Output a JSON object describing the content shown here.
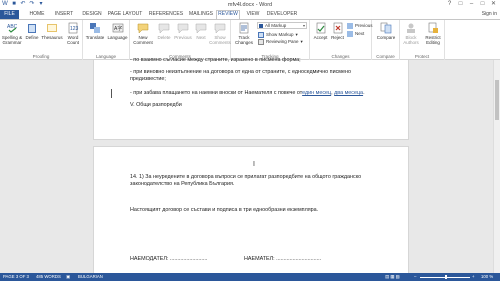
{
  "titlebar": {
    "title": "mfv4l.docx - Word",
    "qat": [
      "W",
      "■",
      "↶",
      "↷",
      "▾"
    ],
    "controls": [
      "?",
      "□",
      "–",
      "□",
      "✕"
    ]
  },
  "tabs": {
    "file": "FILE",
    "home": "HOME",
    "insert": "INSERT",
    "design": "DESIGN",
    "page_layout": "PAGE LAYOUT",
    "references": "REFERENCES",
    "mailings": "MAILINGS",
    "review": "REVIEW",
    "view": "VIEW",
    "developer": "DEVELOPER",
    "user": "Sign in"
  },
  "ribbon": {
    "proofing": {
      "label": "Proofing",
      "spelling": "Spelling &",
      "spelling2": "Grammar",
      "define": "Define",
      "thesaurus": "Thesaurus",
      "word_count": "Word",
      "word_count2": "Count"
    },
    "language": {
      "label": "Language",
      "translate": "Translate",
      "language": "Language"
    },
    "comments": {
      "label": "Comments",
      "new": "New",
      "new2": "Comment",
      "delete": "Delete",
      "previous": "Previous",
      "next": "Next",
      "show": "Show",
      "show2": "Comments"
    },
    "tracking": {
      "label": "Tracking",
      "track": "Track",
      "track2": "Changes",
      "markup": "All Markup",
      "show_markup": "Show Markup",
      "reviewing_pane": "Reviewing Pane"
    },
    "changes": {
      "label": "Changes",
      "accept": "Accept",
      "reject": "Reject",
      "previous": "Previous",
      "next": "Next"
    },
    "compare": {
      "label": "Compare",
      "compare": "Compare"
    },
    "protect": {
      "label": "Protect",
      "block": "Block",
      "block2": "Authors",
      "restrict": "Restrict",
      "restrict2": "Editing"
    }
  },
  "document": {
    "p1_line1": "- по взаимно съгласие между страните, изразено в писмена форма;",
    "p1_line2": "- при виновно неизпълнение на договора от една от страните, с едноседмично писмено",
    "p1_line3": "предизвестие;",
    "p1_line4_a": "- при забава плащането на   наемни вноски от Наемателя с повече от",
    "p1_line4_link1": "един месец",
    "p1_line4_sep": ", ",
    "p1_line4_link2": "два месеца",
    "p1_line4_end": ".",
    "p1_heading": "V. Общи разпоредби",
    "p2_line1": "14. 1) За неуредените в договора въпроси се прилагат разпоредбите на общото гражданско",
    "p2_line2": "законодателство на Република България.",
    "p2_line3": "Настоящият договор се състави и подписа в три еднообразни екземпляра.",
    "p2_sig1": "НАЕМОДАТЕЛ: .........................",
    "p2_sig2": "НАЕМАТЕЛ: ..............................",
    "cursor": "I"
  },
  "status": {
    "page": "PAGE 3 OF 3",
    "words": "485 WORDS",
    "proof_icon": "▣",
    "language": "BULGARIAN",
    "view_icons": "▤ ▦ ▧",
    "zoom_minus": "–",
    "zoom_plus": "+",
    "zoom": "100 %"
  },
  "colors": {
    "accent": "#2b579a",
    "link": "#2b579a"
  }
}
